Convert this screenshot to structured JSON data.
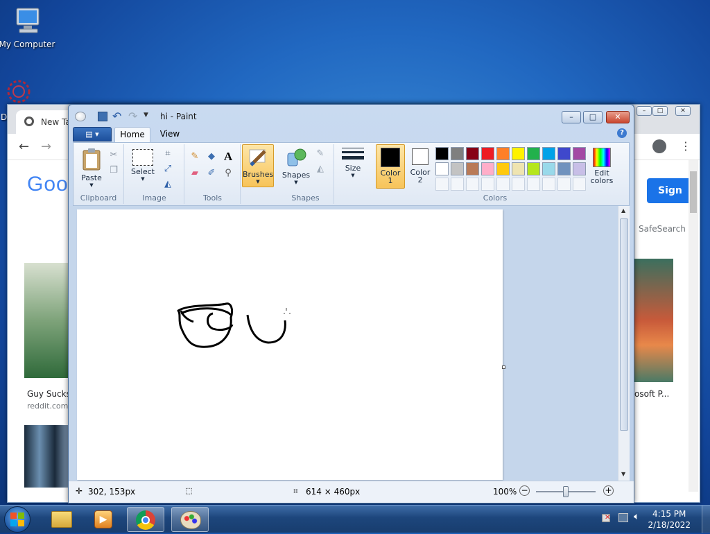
{
  "desktop": {
    "icons": [
      {
        "label": "My Computer",
        "icon": "computer-icon"
      },
      {
        "label": "D",
        "icon": "network-icon"
      }
    ]
  },
  "chrome": {
    "tab_title": "New Ta",
    "logo": "Goo",
    "sign_in": "Sign in",
    "safesearch": "SafeSearch",
    "results": [
      {
        "title": "Guy Sucks",
        "source": "reddit.com"
      },
      {
        "title": "osoft P..."
      }
    ]
  },
  "paint": {
    "title": "hi - Paint",
    "tabs": [
      "Home",
      "View"
    ],
    "groups": {
      "clipboard": "Clipboard",
      "image": "Image",
      "tools": "Tools",
      "shapes": "Shapes",
      "colors": "Colors"
    },
    "buttons": {
      "paste": "Paste",
      "select": "Select",
      "brushes": "Brushes",
      "shapes": "Shapes",
      "size": "Size",
      "color1": "Color",
      "color1_num": "1",
      "color2": "Color",
      "color2_num": "2",
      "edit_colors_1": "Edit",
      "edit_colors_2": "colors"
    },
    "palette": [
      "#000000",
      "#7f7f7f",
      "#880015",
      "#ed1c24",
      "#ff7f27",
      "#fff200",
      "#22b14c",
      "#00a2e8",
      "#3f48cc",
      "#a349a4",
      "#ffffff",
      "#c3c3c3",
      "#b97a57",
      "#ffaec9",
      "#ffc90e",
      "#efe4b0",
      "#b5e61d",
      "#99d9ea",
      "#7092be",
      "#c8bfe7"
    ],
    "color1": "#000000",
    "color2": "#ffffff",
    "status": {
      "cursor": "302, 153px",
      "size": "614 × 460px",
      "zoom": "100%"
    }
  },
  "taskbar": {
    "time": "4:15 PM",
    "date": "2/18/2022"
  }
}
